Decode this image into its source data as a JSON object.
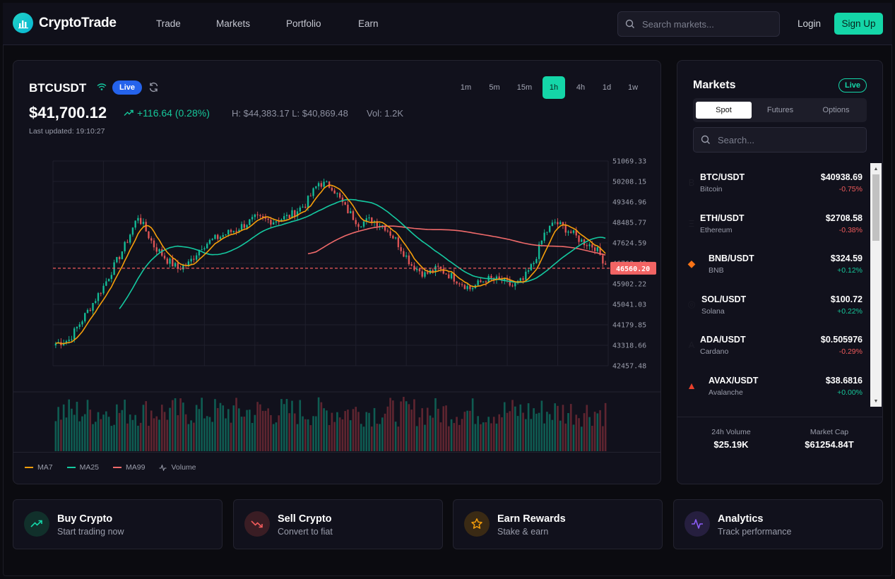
{
  "nav": {
    "brand": "CryptoTrade",
    "links": [
      "Trade",
      "Markets",
      "Portfolio",
      "Earn"
    ],
    "search_placeholder": "Search markets...",
    "login": "Login",
    "signup": "Sign Up"
  },
  "ticker": {
    "symbol": "BTCUSDT",
    "live": "Live",
    "price": "$41,700.12",
    "change": "+116.64 (0.28%)",
    "high_low": "H: $44,383.17 L: $40,869.48",
    "volume": "Vol: 1.2K",
    "updated": "Last updated: 19:10:27",
    "timeframes": [
      "1m",
      "5m",
      "15m",
      "1h",
      "4h",
      "1d",
      "1w"
    ],
    "active_timeframe": "1h"
  },
  "chart_data": {
    "type": "candlestick",
    "ylim": [
      42457.48,
      51069.33
    ],
    "y_ticks": [
      "51069.33",
      "50208.15",
      "49346.96",
      "48485.77",
      "47624.59",
      "46763.40",
      "45902.22",
      "45041.03",
      "44179.85",
      "43318.66",
      "42457.48"
    ],
    "current_price_label": "46560.20",
    "current_price": 46560.2,
    "close_keyframes": [
      [
        0,
        43400
      ],
      [
        5,
        43550
      ],
      [
        10,
        44400
      ],
      [
        18,
        45800
      ],
      [
        26,
        47500
      ],
      [
        31,
        48750
      ],
      [
        37,
        47500
      ],
      [
        42,
        46900
      ],
      [
        46,
        46550
      ],
      [
        50,
        46750
      ],
      [
        55,
        47500
      ],
      [
        60,
        47800
      ],
      [
        68,
        48200
      ],
      [
        75,
        48650
      ],
      [
        82,
        48550
      ],
      [
        88,
        48750
      ],
      [
        94,
        49250
      ],
      [
        99,
        50150
      ],
      [
        104,
        50000
      ],
      [
        109,
        49100
      ],
      [
        114,
        48450
      ],
      [
        119,
        48600
      ],
      [
        124,
        48300
      ],
      [
        128,
        47750
      ],
      [
        134,
        46700
      ],
      [
        139,
        46300
      ],
      [
        144,
        46550
      ],
      [
        150,
        46150
      ],
      [
        156,
        45700
      ],
      [
        162,
        46100
      ],
      [
        168,
        46050
      ],
      [
        172,
        45800
      ],
      [
        176,
        46050
      ],
      [
        180,
        46800
      ],
      [
        184,
        48000
      ],
      [
        188,
        48500
      ],
      [
        193,
        48150
      ],
      [
        198,
        47700
      ],
      [
        203,
        47450
      ],
      [
        207,
        46750
      ]
    ],
    "series": [
      {
        "name": "MA7",
        "color": "#f59e0b"
      },
      {
        "name": "MA25",
        "color": "#14c9a0"
      },
      {
        "name": "MA99",
        "color": "#f06a6a"
      },
      {
        "name": "Volume"
      }
    ],
    "up_color": "#14c9a0",
    "down_color": "#f05b5b"
  },
  "markets": {
    "title": "Markets",
    "live": "Live",
    "tabs": [
      "Spot",
      "Futures",
      "Options"
    ],
    "active_tab": "Spot",
    "search_placeholder": "Search...",
    "items": [
      {
        "pair": "BTC/USDT",
        "name": "Bitcoin",
        "price": "$40938.69",
        "change": "-0.75%",
        "dir": "down",
        "icon": "B",
        "icon_color": "#1b1b26"
      },
      {
        "pair": "ETH/USDT",
        "name": "Ethereum",
        "price": "$2708.58",
        "change": "-0.38%",
        "dir": "down",
        "icon": "Ξ",
        "icon_color": "#1b1b26"
      },
      {
        "pair": "BNB/USDT",
        "name": "BNB",
        "price": "$324.59",
        "change": "+0.12%",
        "dir": "up",
        "icon": "◆",
        "icon_color": "#f97316"
      },
      {
        "pair": "SOL/USDT",
        "name": "Solana",
        "price": "$100.72",
        "change": "+0.22%",
        "dir": "up",
        "icon": "◎",
        "icon_color": "#1b1b26"
      },
      {
        "pair": "ADA/USDT",
        "name": "Cardano",
        "price": "$0.505976",
        "change": "-0.29%",
        "dir": "down",
        "icon": "A",
        "icon_color": "#1b1b26"
      },
      {
        "pair": "AVAX/USDT",
        "name": "Avalanche",
        "price": "$38.6816",
        "change": "+0.00%",
        "dir": "up",
        "icon": "▲",
        "icon_color": "#e8412c"
      }
    ],
    "stats": [
      {
        "label": "24h Volume",
        "value": "$25.19K"
      },
      {
        "label": "Market Cap",
        "value": "$61254.84T"
      }
    ]
  },
  "cards": [
    {
      "title": "Buy Crypto",
      "subtitle": "Start trading now",
      "icon": "trend-up-icon",
      "color": "#14d6a8",
      "bg": "#11302b"
    },
    {
      "title": "Sell Crypto",
      "subtitle": "Convert to fiat",
      "icon": "trend-down-icon",
      "color": "#f05b5b",
      "bg": "#3a1d24"
    },
    {
      "title": "Earn Rewards",
      "subtitle": "Stake & earn",
      "icon": "star-icon",
      "color": "#f59e0b",
      "bg": "#3a2a14"
    },
    {
      "title": "Analytics",
      "subtitle": "Track performance",
      "icon": "activity-icon",
      "color": "#8b5cf6",
      "bg": "#261f3f"
    }
  ]
}
